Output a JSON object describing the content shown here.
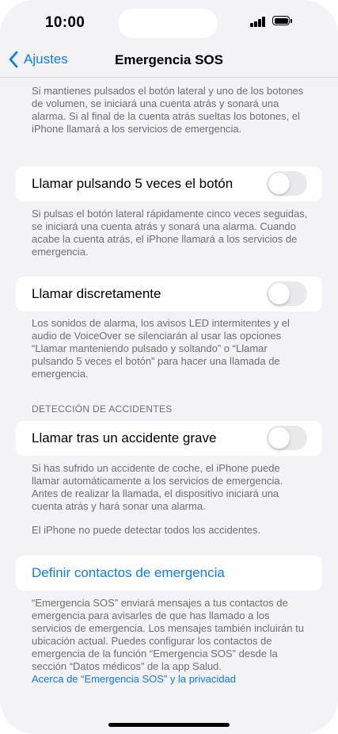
{
  "status": {
    "time": "10:00"
  },
  "nav": {
    "back_label": "Ajustes",
    "title": "Emergencia SOS"
  },
  "intro_desc": "Si mantienes pulsados el botón lateral y uno de los botones de volumen, se iniciará una cuenta atrás y sonará una alarma. Si al final de la cuenta atrás sueltas los botones, el iPhone llamará a los servicios de emergencia.",
  "five_presses": {
    "label": "Llamar pulsando 5 veces el botón",
    "enabled": false,
    "desc": "Si pulsas el botón lateral rápidamente cinco veces seguidas, se iniciará una cuenta atrás y sonará una alarma. Cuando acabe la cuenta atrás, el iPhone llamará a los servicios de emergencia."
  },
  "silent_call": {
    "label": "Llamar discretamente",
    "enabled": false,
    "desc": "Los sonidos de alarma, los avisos LED intermitentes y el audio de VoiceOver se silenciarán al usar las opciones “Llamar manteniendo pulsado y soltando” o “Llamar pulsando 5 veces el botón” para hacer una llamada de emergencia."
  },
  "crash_detection": {
    "header": "DETECCIÓN DE ACCIDENTES",
    "label": "Llamar tras un accidente grave",
    "enabled": false,
    "desc": "Si has sufrido un accidente de coche, el iPhone puede llamar automáticamente a los servicios de emergencia. Antes de realizar la llamada, el dispositivo iniciará una cuenta atrás y hará sonar una alarma.",
    "note": "El iPhone no puede detectar todos los accidentes."
  },
  "contacts": {
    "label": "Definir contactos de emergencia",
    "desc": "“Emergencia SOS” enviará mensajes a tus contactos de emergencia para avisarles de que has llamado a los servicios de emergencia. Los mensajes también incluirán tu ubicación actual. Puedes configurar los contactos de emergencia de la función “Emergencia SOS” desde la sección “Datos médicos” de la app Salud.",
    "privacy_link": "Acerca de “Emergencia SOS” y la privacidad"
  },
  "colors": {
    "accent": "#0a7aff",
    "background": "#f2f2f7",
    "secondary_text": "#6d6d72",
    "toggle_off": "#e9e9eb"
  }
}
